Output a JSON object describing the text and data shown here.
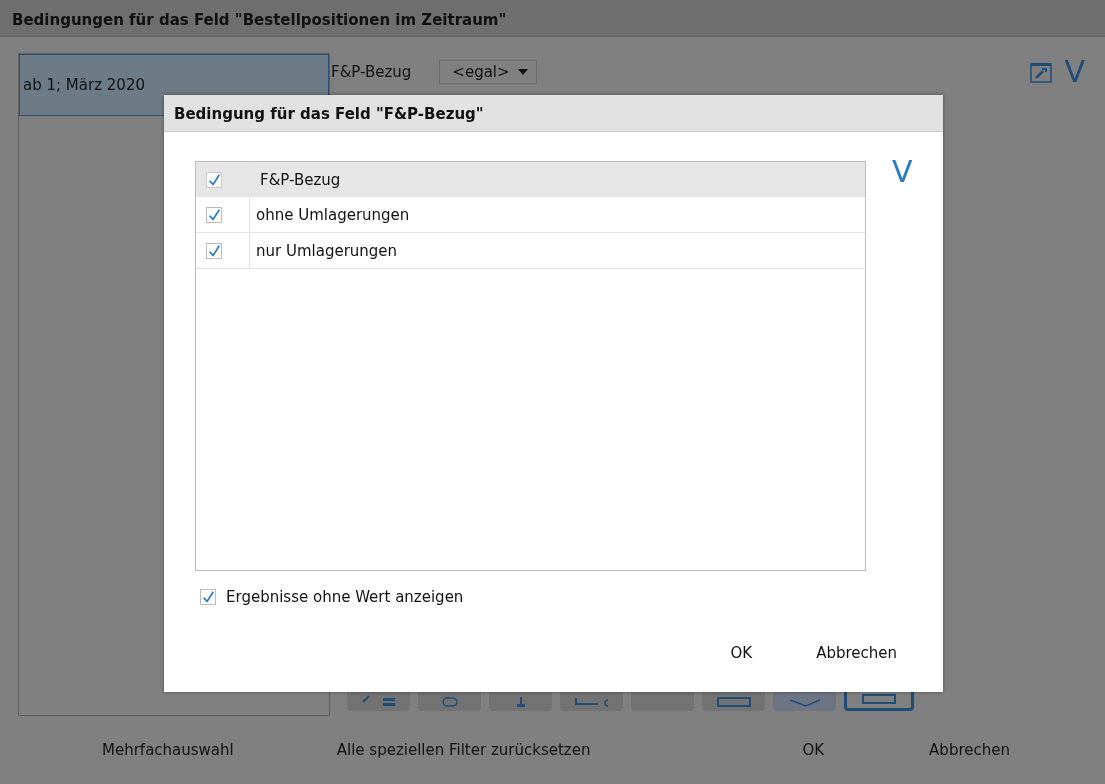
{
  "window": {
    "title": "Bedingungen für das Feld \"Bestellpositionen im Zeitraum\""
  },
  "left_panel": {
    "items": [
      {
        "label": "ab 1; März 2020",
        "selected": true
      }
    ]
  },
  "filter": {
    "label": "F&P-Bezug",
    "dropdown": {
      "value": "<egal>"
    }
  },
  "top_right": {
    "v_label": "V"
  },
  "toolbar_buttons": [
    {
      "selected": false
    },
    {
      "selected": false
    },
    {
      "selected": false
    },
    {
      "selected": false
    },
    {
      "selected": false
    },
    {
      "selected": false
    },
    {
      "selected": false
    },
    {
      "selected": true
    }
  ],
  "footer": {
    "buttons": [
      "Mehrfachauswahl",
      "Alle speziellen Filter zurücksetzen",
      "OK",
      "Abbrechen"
    ]
  },
  "dialog": {
    "title": "Bedingung für das Feld \"F&P-Bezug\"",
    "v_label": "V",
    "table": {
      "header": {
        "label": "F&P-Bezug",
        "checked": true
      },
      "rows": [
        {
          "label": "ohne Umlagerungen",
          "checked": true
        },
        {
          "label": "nur Umlagerungen",
          "checked": true
        }
      ]
    },
    "show_empty": {
      "label": "Ergebnisse ohne Wert anzeigen",
      "checked": true
    },
    "buttons": [
      "OK",
      "Abbrechen"
    ]
  }
}
